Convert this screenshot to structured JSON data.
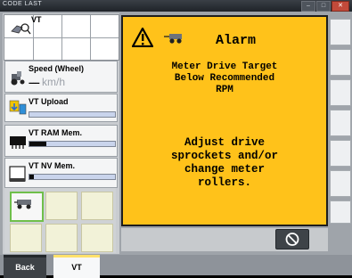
{
  "window": {
    "title": "CODE LAST",
    "controls": [
      "–",
      "□",
      "✕"
    ]
  },
  "left_panel": {
    "vt_label": "VT",
    "speed": {
      "label": "Speed (Wheel)",
      "value": "-----",
      "unit": "km/h"
    },
    "vt_upload": {
      "label": "VT Upload",
      "progress": 0
    },
    "vt_ram": {
      "label": "VT RAM Mem.",
      "progress": 0.2
    },
    "vt_nv": {
      "label": "VT NV Mem.",
      "progress": 0.05
    }
  },
  "alarm": {
    "title": "Alarm",
    "message_1": [
      "Meter Drive Target",
      "Below Recommended",
      "RPM"
    ],
    "message_2": [
      "Adjust drive",
      "sprockets and/or",
      "change meter",
      "rollers."
    ],
    "accent_color": "#ffc21a"
  },
  "tabs": [
    {
      "label": "Back"
    },
    {
      "label": "VT"
    }
  ],
  "icons": {
    "acknowledge": "acknowledge-icon",
    "warning": "warning-triangle-icon",
    "machine": "planter-icon"
  }
}
